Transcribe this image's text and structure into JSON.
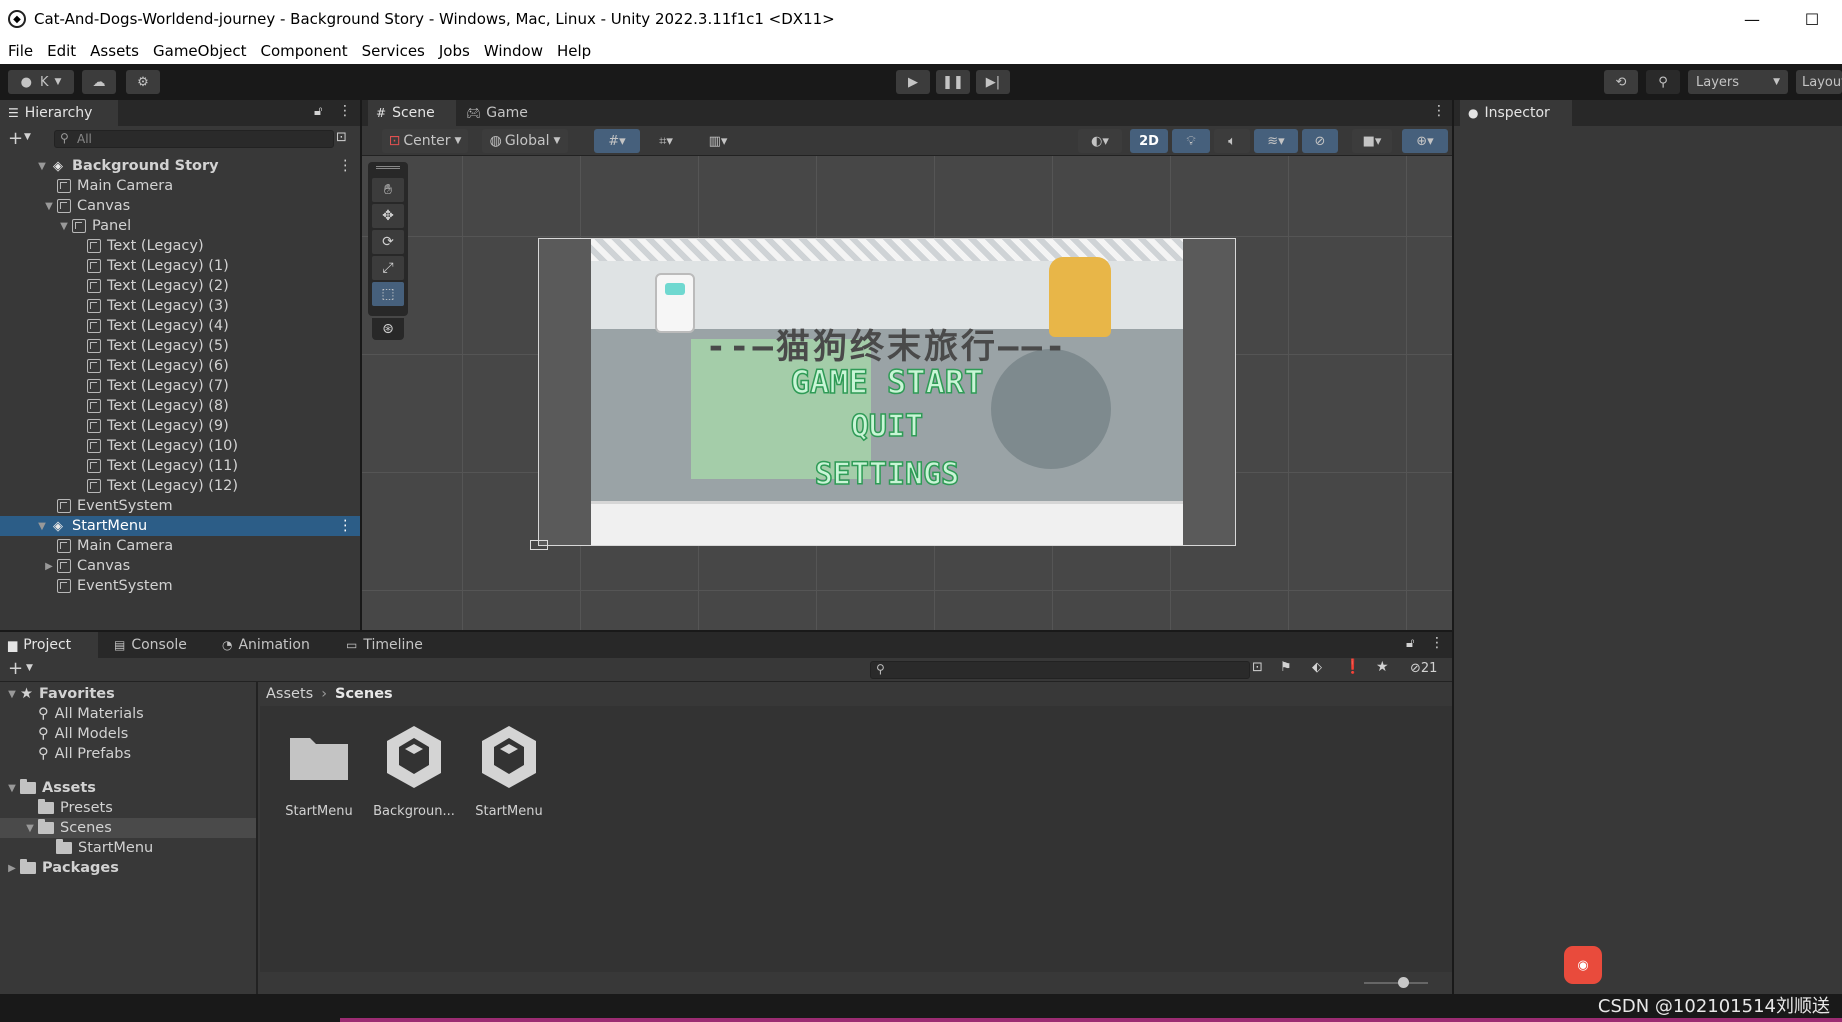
{
  "window": {
    "title": "Cat-And-Dogs-Worldend-journey - Background Story - Windows, Mac, Linux - Unity 2022.3.11f1c1 <DX11>",
    "minimize": "—",
    "maximize": "☐"
  },
  "menu": [
    "File",
    "Edit",
    "Assets",
    "GameObject",
    "Component",
    "Services",
    "Jobs",
    "Window",
    "Help"
  ],
  "toolbar": {
    "account": "K",
    "layers": "Layers",
    "layout": "Layout"
  },
  "hierarchy": {
    "tab": "Hierarchy",
    "search_placeholder": "All",
    "rows": [
      {
        "label": "Background Story",
        "depth": 0,
        "kind": "scene",
        "fold": "▼",
        "bold": true
      },
      {
        "label": "Main Camera",
        "depth": 1,
        "kind": "obj",
        "fold": ""
      },
      {
        "label": "Canvas",
        "depth": 1,
        "kind": "obj",
        "fold": "▼"
      },
      {
        "label": "Panel",
        "depth": 2,
        "kind": "obj",
        "fold": "▼"
      },
      {
        "label": "Text (Legacy)",
        "depth": 3,
        "kind": "obj",
        "fold": ""
      },
      {
        "label": "Text (Legacy) (1)",
        "depth": 3,
        "kind": "obj",
        "fold": ""
      },
      {
        "label": "Text (Legacy) (2)",
        "depth": 3,
        "kind": "obj",
        "fold": ""
      },
      {
        "label": "Text (Legacy) (3)",
        "depth": 3,
        "kind": "obj",
        "fold": ""
      },
      {
        "label": "Text (Legacy) (4)",
        "depth": 3,
        "kind": "obj",
        "fold": ""
      },
      {
        "label": "Text (Legacy) (5)",
        "depth": 3,
        "kind": "obj",
        "fold": ""
      },
      {
        "label": "Text (Legacy) (6)",
        "depth": 3,
        "kind": "obj",
        "fold": ""
      },
      {
        "label": "Text (Legacy) (7)",
        "depth": 3,
        "kind": "obj",
        "fold": ""
      },
      {
        "label": "Text (Legacy) (8)",
        "depth": 3,
        "kind": "obj",
        "fold": ""
      },
      {
        "label": "Text (Legacy) (9)",
        "depth": 3,
        "kind": "obj",
        "fold": ""
      },
      {
        "label": "Text (Legacy) (10)",
        "depth": 3,
        "kind": "obj",
        "fold": ""
      },
      {
        "label": "Text (Legacy) (11)",
        "depth": 3,
        "kind": "obj",
        "fold": ""
      },
      {
        "label": "Text (Legacy) (12)",
        "depth": 3,
        "kind": "obj",
        "fold": ""
      },
      {
        "label": "EventSystem",
        "depth": 1,
        "kind": "obj",
        "fold": ""
      },
      {
        "label": "StartMenu",
        "depth": 0,
        "kind": "scene",
        "fold": "▼",
        "selected": true
      },
      {
        "label": "Main Camera",
        "depth": 1,
        "kind": "obj",
        "fold": ""
      },
      {
        "label": "Canvas",
        "depth": 1,
        "kind": "obj",
        "fold": "▶"
      },
      {
        "label": "EventSystem",
        "depth": 1,
        "kind": "obj",
        "fold": ""
      }
    ]
  },
  "scene": {
    "tabs": [
      "Scene",
      "Game"
    ],
    "pivot": "Center",
    "space": "Global",
    "mode_2d": "2D",
    "game_title": "--—猫狗终末旅行——-",
    "menu_items": [
      "GAME START",
      "QUIT",
      "SETTINGS"
    ]
  },
  "project": {
    "tabs": [
      "Project",
      "Console",
      "Animation",
      "Timeline"
    ],
    "hidden_count": "21",
    "tree": [
      {
        "label": "Favorites",
        "depth": 0,
        "kind": "star",
        "fold": "▼",
        "bold": true
      },
      {
        "label": "All Materials",
        "depth": 1,
        "kind": "search",
        "fold": ""
      },
      {
        "label": "All Models",
        "depth": 1,
        "kind": "search",
        "fold": ""
      },
      {
        "label": "All Prefabs",
        "depth": 1,
        "kind": "search",
        "fold": ""
      },
      {
        "label": "Assets",
        "depth": 0,
        "kind": "folder",
        "fold": "▼",
        "bold": true
      },
      {
        "label": "Presets",
        "depth": 1,
        "kind": "folder",
        "fold": ""
      },
      {
        "label": "Scenes",
        "depth": 1,
        "kind": "folder",
        "fold": "▼",
        "selected": true
      },
      {
        "label": "StartMenu",
        "depth": 2,
        "kind": "folder",
        "fold": ""
      },
      {
        "label": "Packages",
        "depth": 0,
        "kind": "folder",
        "fold": "▶",
        "bold": true
      }
    ],
    "breadcrumb": [
      "Assets",
      "Scenes"
    ],
    "assets": [
      {
        "label": "StartMenu",
        "kind": "folder"
      },
      {
        "label": "Backgroun...",
        "kind": "unity"
      },
      {
        "label": "StartMenu",
        "kind": "unity"
      }
    ]
  },
  "inspector": {
    "tab": "Inspector"
  },
  "watermark": "CSDN @102101514刘顺送"
}
